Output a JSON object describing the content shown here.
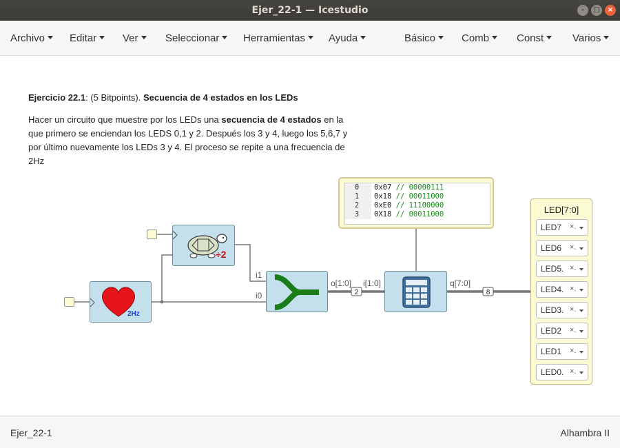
{
  "window": {
    "title": "Ejer_22-1 — Icestudio"
  },
  "menu": {
    "left": [
      "Archivo",
      "Editar",
      "Ver",
      "Seleccionar",
      "Herramientas",
      "Ayuda"
    ],
    "right": [
      "Básico",
      "Comb",
      "Const",
      "Varios"
    ]
  },
  "info": {
    "title_bold": "Ejercicio 22.1",
    "title_mid": ": (5 Bitpoints). ",
    "title_bold2": "Secuencia de 4 estados en los LEDs",
    "p1_a": "Hacer un circuito que muestre por los LEDs una ",
    "p1_b": "secuencia de 4 estados",
    "p1_c": " en la que primero se enciendan los LEDS 0,1 y 2. Después los 3 y 4, luego los 5,6,7 y por último nuevamente los LEDs 3 y 4. El proceso se repite a una frecuencia de 2Hz"
  },
  "blocks": {
    "heartbeat_label": "2Hz",
    "divider_label": "÷2",
    "mux_i1": "i1",
    "mux_i0": "i0",
    "mux_out": "o[1:0]",
    "rom_in": "i[1:0]",
    "rom_out": "q[7:0]",
    "bus_width_a": "2",
    "bus_width_b": "8"
  },
  "memory": {
    "rows": [
      {
        "n": "0",
        "hex": "0x07",
        "bin": "00000111"
      },
      {
        "n": "1",
        "hex": "0x18",
        "bin": "00011000"
      },
      {
        "n": "2",
        "hex": "0xE0",
        "bin": "11100000"
      },
      {
        "n": "3",
        "hex": "0X18",
        "bin": "00011000"
      }
    ]
  },
  "leds": {
    "title": "LED[7:0]",
    "items": [
      "LED7",
      "LED6",
      "LED5.",
      "LED4.",
      "LED3.",
      "LED2",
      "LED1",
      "LED0."
    ],
    "clear": "×."
  },
  "status": {
    "left": "Ejer_22-1",
    "right": "Alhambra II"
  }
}
